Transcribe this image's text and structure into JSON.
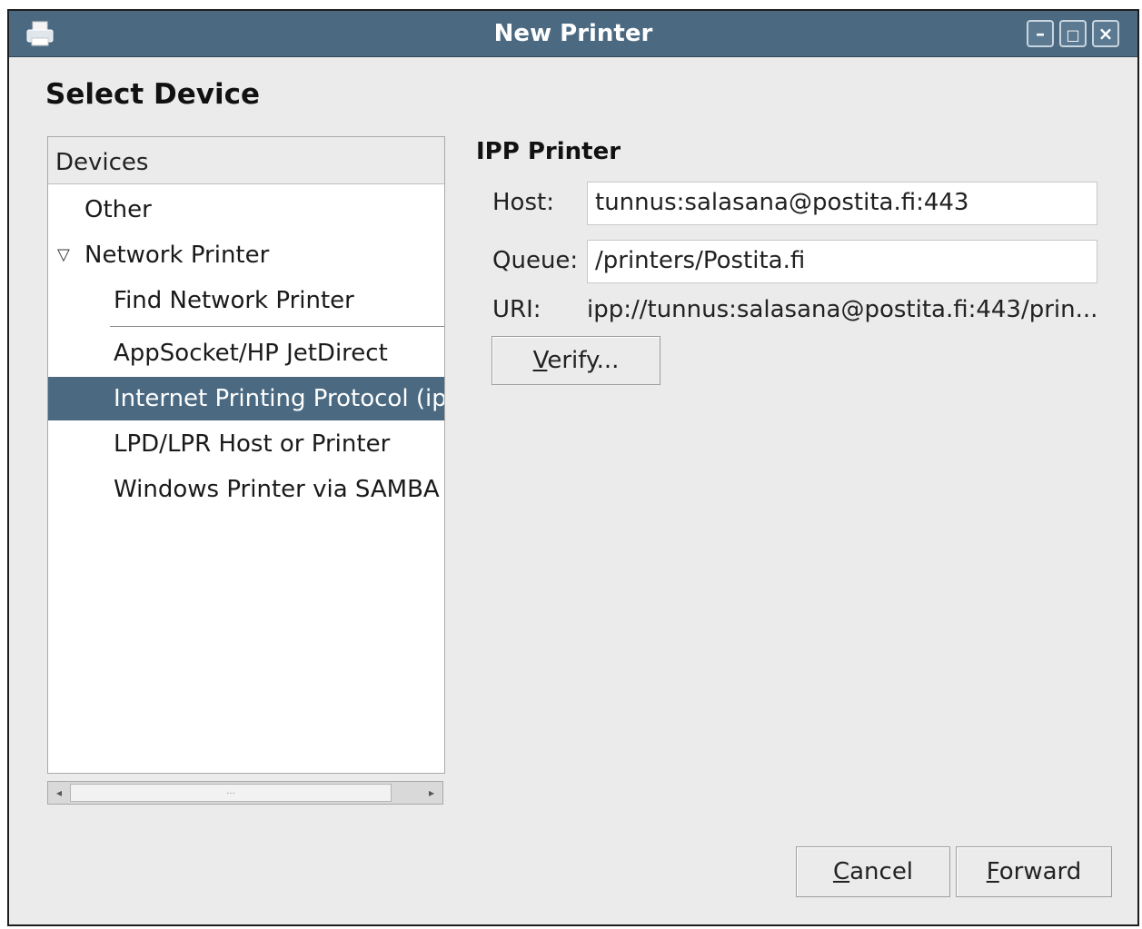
{
  "window": {
    "title": "New Printer"
  },
  "page": {
    "heading": "Select Device"
  },
  "devices": {
    "header": "Devices",
    "items": [
      {
        "label": "Other"
      },
      {
        "label": "Network Printer"
      },
      {
        "label": "Find Network Printer"
      },
      {
        "label": "AppSocket/HP JetDirect"
      },
      {
        "label": "Internet Printing Protocol (ip"
      },
      {
        "label": "LPD/LPR Host or Printer"
      },
      {
        "label": "Windows Printer via SAMBA"
      }
    ],
    "selected": "Internet Printing Protocol (ip",
    "scroll_dots": "..."
  },
  "ipp": {
    "title": "IPP Printer",
    "host_label": "Host:",
    "host_value": "tunnus:salasana@postita.fi:443",
    "queue_label": "Queue:",
    "queue_value": "/printers/Postita.fi",
    "uri_label": "URI:",
    "uri_value": "ipp://tunnus:salasana@postita.fi:443/prin...",
    "verify_mnemonic": "V",
    "verify_rest": "erify..."
  },
  "buttons": {
    "cancel_mnemonic": "C",
    "cancel_rest": "ancel",
    "forward_mnemonic": "F",
    "forward_rest": "orward"
  },
  "colors": {
    "titlebar": "#4b6a82",
    "selection": "#4b6a82",
    "background": "#ebebeb"
  }
}
